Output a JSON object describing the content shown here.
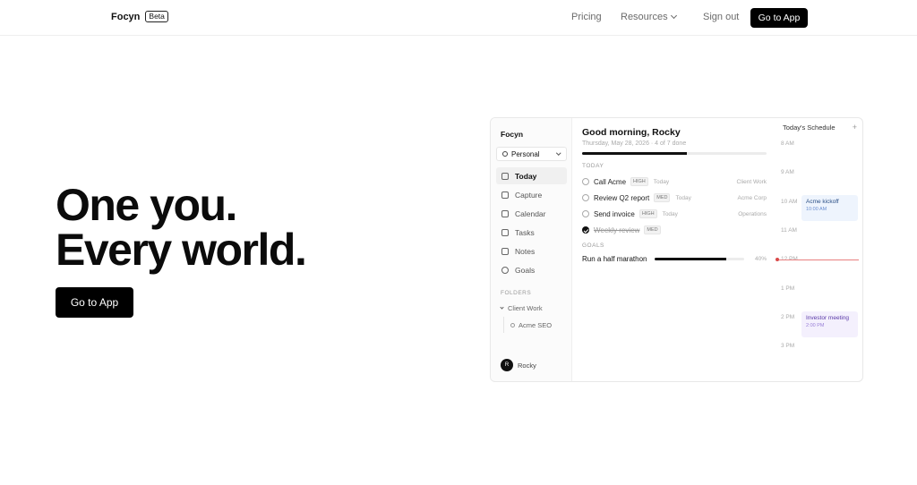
{
  "nav": {
    "brand": "Focyn",
    "badge": "Beta",
    "links": [
      "Pricing",
      "Resources",
      "Sign out"
    ],
    "cta": "Go to App"
  },
  "hero": {
    "line1": "One you.",
    "line2": "Every world.",
    "cta": "Go to App"
  },
  "app": {
    "sidebar": {
      "brand": "Focyn",
      "workspace": "Personal",
      "items": [
        {
          "label": "Today",
          "icon": "calendar-icon",
          "active": true
        },
        {
          "label": "Capture",
          "icon": "inbox-icon",
          "active": false
        },
        {
          "label": "Calendar",
          "icon": "calendar-icon",
          "active": false
        },
        {
          "label": "Tasks",
          "icon": "checkbox-icon",
          "active": false
        },
        {
          "label": "Notes",
          "icon": "note-icon",
          "active": false
        },
        {
          "label": "Goals",
          "icon": "target-icon",
          "active": false
        }
      ],
      "folders_heading": "FOLDERS",
      "folder": "Client Work",
      "subfolder": "Acme SEO",
      "user_initial": "R",
      "user_name": "Rocky"
    },
    "main": {
      "greeting": "Good morning, Rocky",
      "date_line": "Thursday, May 28, 2026 · 4 of 7 done",
      "progress": 0.57,
      "today_heading": "TODAY",
      "tasks": [
        {
          "name": "Call Acme",
          "priority": "HIGH",
          "due": "Today",
          "project": "Client Work",
          "done": false
        },
        {
          "name": "Review Q2 report",
          "priority": "MED",
          "due": "Today",
          "project": "Acme Corp",
          "done": false
        },
        {
          "name": "Send invoice",
          "priority": "HIGH",
          "due": "Today",
          "project": "Operations",
          "done": false
        },
        {
          "name": "Weekly review",
          "priority": "MED",
          "due": "",
          "project": "",
          "done": true
        }
      ],
      "goals_heading": "GOALS",
      "goal": {
        "name": "Run a half marathon",
        "percent_label": "40%",
        "progress": 0.8
      }
    },
    "schedule": {
      "title": "Today's Schedule",
      "add": "+",
      "hours": [
        "8 AM",
        "9 AM",
        "10 AM",
        "11 AM",
        "12 PM",
        "1 PM",
        "2 PM",
        "3 PM"
      ],
      "events": [
        {
          "title": "Acme kickoff",
          "time": "10:00 AM"
        },
        {
          "title": "Investor meeting",
          "time": "2:00 PM"
        }
      ]
    }
  }
}
